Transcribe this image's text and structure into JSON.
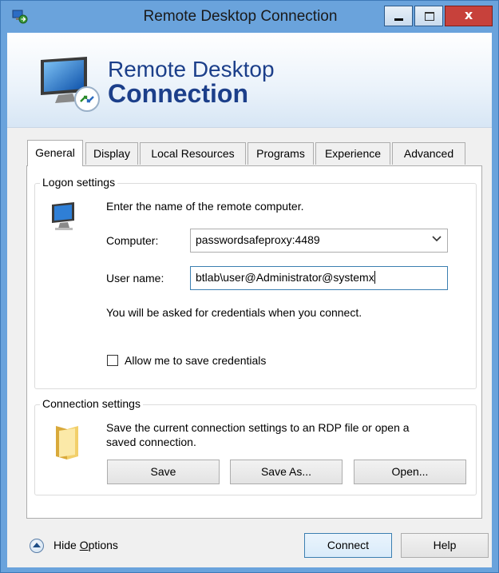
{
  "window": {
    "title": "Remote Desktop Connection",
    "controls": {
      "minimize": "minimize",
      "maximize": "maximize",
      "close": "x"
    }
  },
  "banner": {
    "line1": "Remote Desktop",
    "line2": "Connection"
  },
  "tabs": [
    {
      "label": "General",
      "active": true
    },
    {
      "label": "Display",
      "active": false
    },
    {
      "label": "Local Resources",
      "active": false
    },
    {
      "label": "Programs",
      "active": false
    },
    {
      "label": "Experience",
      "active": false
    },
    {
      "label": "Advanced",
      "active": false
    }
  ],
  "logon": {
    "legend": "Logon settings",
    "instruction": "Enter the name of the remote computer.",
    "computer_label": "Computer:",
    "computer_value": "passwordsafeproxy:4489",
    "username_label": "User name:",
    "username_value": "btlab\\user@Administrator@systemx",
    "credentials_note": "You will be asked for credentials when you connect.",
    "save_credentials_label": "Allow me to save credentials",
    "save_credentials_checked": false
  },
  "connection": {
    "legend": "Connection settings",
    "description_line1": "Save the current connection settings to an RDP file or open a",
    "description_line2": "saved connection.",
    "save_label": "Save",
    "save_as_label": "Save As...",
    "open_label": "Open..."
  },
  "footer": {
    "hide_options_prefix": "Hide ",
    "hide_options_accel": "O",
    "hide_options_suffix": "ptions",
    "connect_label": "Connect",
    "help_label": "Help"
  },
  "icons": {
    "app": "remote-desktop-icon",
    "banner": "remote-desktop-computer-icon",
    "logon": "computer-icon",
    "connection": "folder-icon",
    "hide_options": "chevron-up-circle-icon",
    "dropdown": "chevron-down-icon"
  },
  "colors": {
    "title_bar": "#6aa3dc",
    "close_button": "#c7413b",
    "banner_text": "#1c3f8a",
    "focus_border": "#3c7fb1"
  }
}
